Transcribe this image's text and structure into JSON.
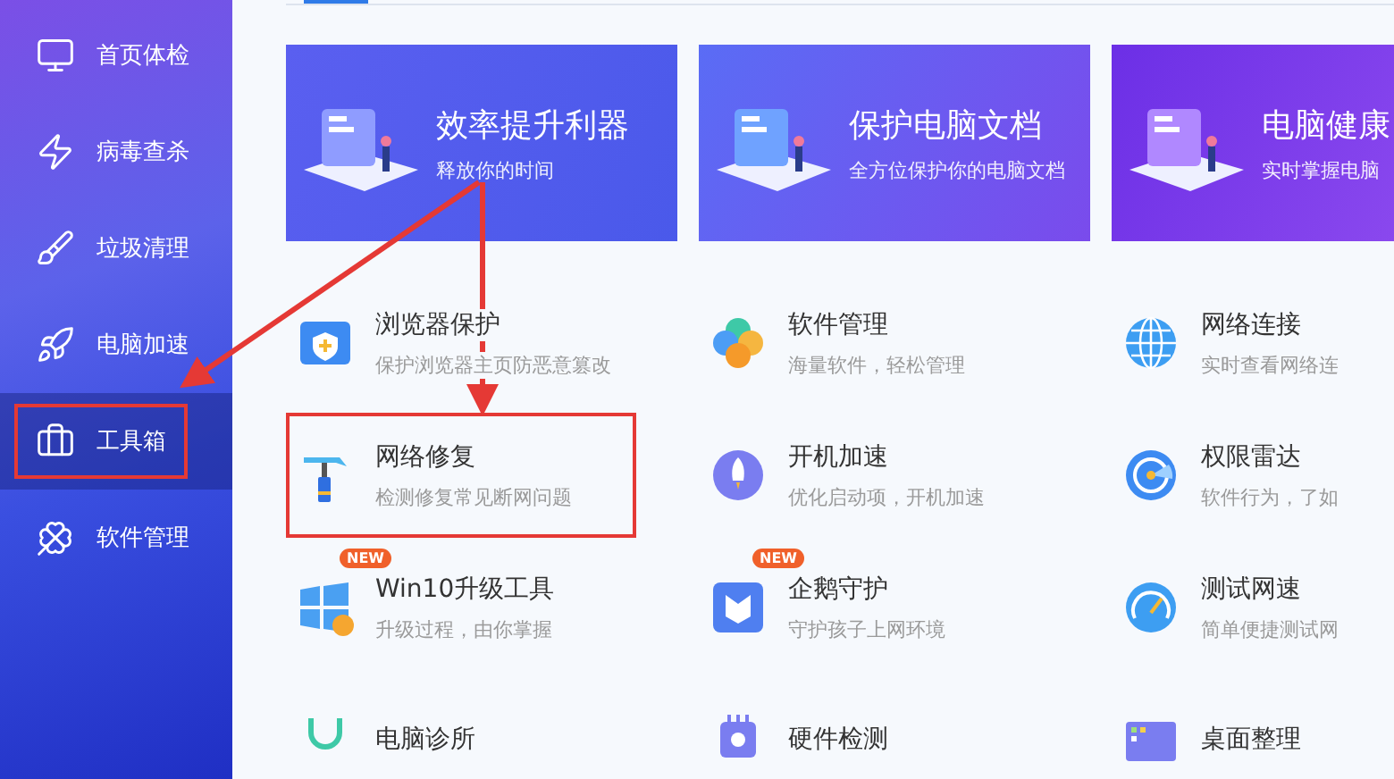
{
  "sidebar": {
    "items": [
      {
        "label": "首页体检",
        "selected": false,
        "highlighted": false
      },
      {
        "label": "病毒查杀",
        "selected": false,
        "highlighted": false
      },
      {
        "label": "垃圾清理",
        "selected": false,
        "highlighted": false
      },
      {
        "label": "电脑加速",
        "selected": false,
        "highlighted": false
      },
      {
        "label": "工具箱",
        "selected": true,
        "highlighted": true
      },
      {
        "label": "软件管理",
        "selected": false,
        "highlighted": false
      }
    ]
  },
  "banners": [
    {
      "title": "效率提升利器",
      "subtitle": "释放你的时间"
    },
    {
      "title": "保护电脑文档",
      "subtitle": "全方位保护你的电脑文档"
    },
    {
      "title": "电脑健康",
      "subtitle": "实时掌握电脑"
    }
  ],
  "tools": [
    {
      "name": "浏览器保护",
      "description": "保护浏览器主页防恶意篡改",
      "highlighted": false
    },
    {
      "name": "软件管理",
      "description": "海量软件，轻松管理",
      "highlighted": false
    },
    {
      "name": "网络连接",
      "description": "实时查看网络连",
      "highlighted": false
    },
    {
      "name": "网络修复",
      "description": "检测修复常见断网问题",
      "highlighted": true
    },
    {
      "name": "开机加速",
      "description": "优化启动项，开机加速",
      "highlighted": false
    },
    {
      "name": "权限雷达",
      "description": "软件行为，了如",
      "highlighted": false
    },
    {
      "name": "Win10升级工具",
      "description": "升级过程，由你掌握",
      "badge": "NEW",
      "highlighted": false
    },
    {
      "name": "企鹅守护",
      "description": "守护孩子上网环境",
      "badge": "NEW",
      "highlighted": false
    },
    {
      "name": "测试网速",
      "description": "简单便捷测试网",
      "highlighted": false
    },
    {
      "name": "电脑诊所",
      "highlighted": false
    },
    {
      "name": "硬件检测",
      "highlighted": false
    },
    {
      "name": "桌面整理",
      "highlighted": false
    }
  ]
}
